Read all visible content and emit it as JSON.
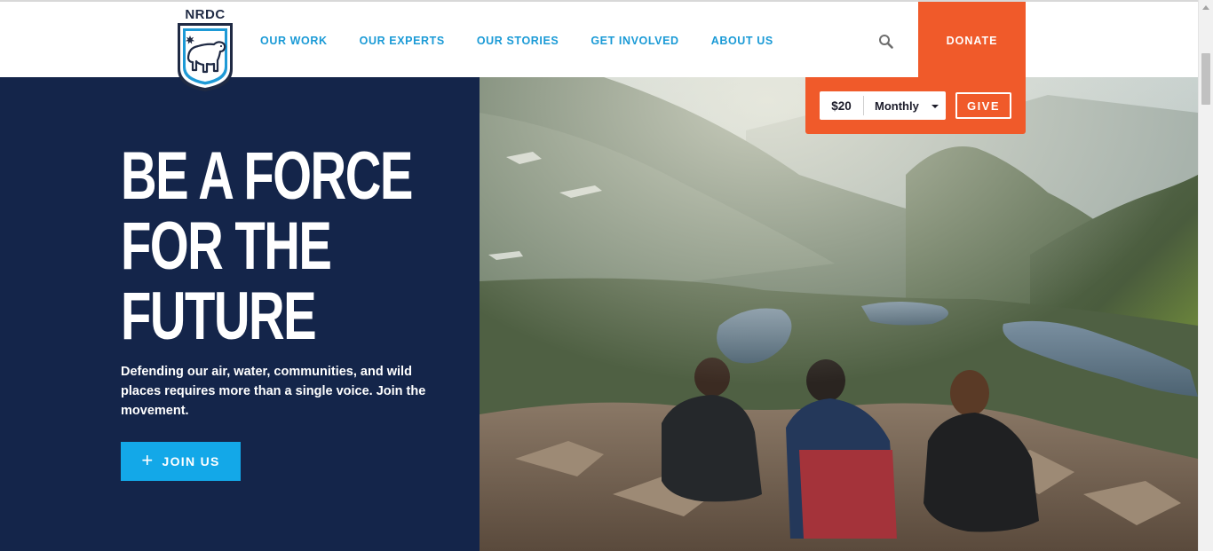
{
  "header": {
    "logo_text": "NRDC",
    "nav": [
      {
        "label": "OUR WORK"
      },
      {
        "label": "OUR EXPERTS"
      },
      {
        "label": "OUR STORIES"
      },
      {
        "label": "GET INVOLVED"
      },
      {
        "label": "ABOUT US"
      }
    ],
    "search_icon": "search-icon",
    "donate_label": "DONATE"
  },
  "give_panel": {
    "amount": "$20",
    "frequency": "Monthly",
    "give_label": "GIVE"
  },
  "hero": {
    "headline_lines": [
      "BE A FORCE",
      "FOR THE",
      "FUTURE"
    ],
    "subtext": "Defending our air, water, communities, and wild places requires more than a single voice. Join the movement.",
    "join_label": "JOIN US",
    "join_icon": "plus-icon"
  },
  "colors": {
    "navy": "#14254a",
    "brand_blue": "#1a9ad6",
    "cta_blue": "#13a8e8",
    "donate_orange": "#f05a2a"
  }
}
